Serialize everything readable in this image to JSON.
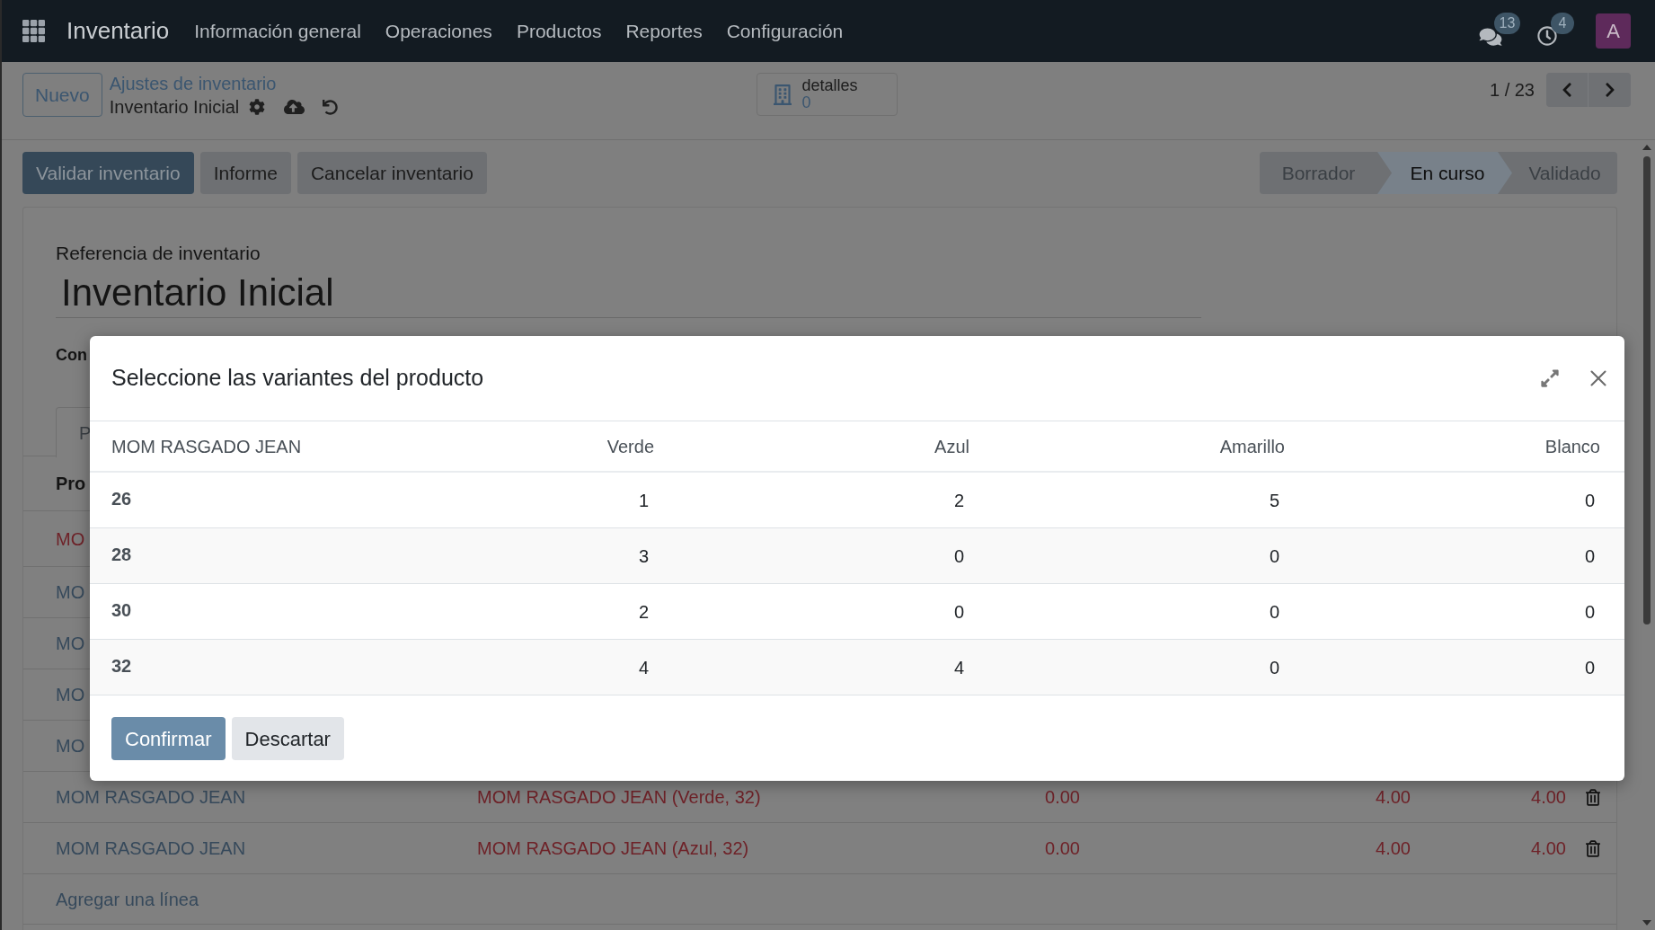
{
  "navbar": {
    "app_name": "Inventario",
    "menu": [
      "Información general",
      "Operaciones",
      "Productos",
      "Reportes",
      "Configuración"
    ],
    "messages_badge": "13",
    "activities_badge": "4",
    "avatar": "A"
  },
  "control_panel": {
    "new_button": "Nuevo",
    "breadcrumb": "Ajustes de inventario",
    "record_title": "Inventario Inicial",
    "stat_button": {
      "label": "detalles",
      "value": "0"
    },
    "pager": "1 / 23"
  },
  "actions": [
    {
      "label": "Validar inventario",
      "kind": "primary"
    },
    {
      "label": "Informe",
      "kind": "secondary"
    },
    {
      "label": "Cancelar inventario",
      "kind": "secondary"
    }
  ],
  "status_steps": [
    {
      "label": "Borrador",
      "selected": false
    },
    {
      "label": "En curso",
      "selected": true
    },
    {
      "label": "Validado",
      "selected": false
    }
  ],
  "sheet": {
    "reference_label": "Referencia de inventario",
    "reference_value": "Inventario Inicial",
    "field_label": "Con",
    "tab": "P",
    "list": {
      "column_1": "Pro",
      "rows": [
        {
          "product": "MO",
          "warning": true
        },
        {
          "product": "MO",
          "warning": false
        },
        {
          "product": "MO",
          "warning": false
        },
        {
          "product": "MO",
          "warning": false
        },
        {
          "product": "MO",
          "warning": false
        },
        {
          "product": "MOM RASGADO JEAN",
          "warning": false,
          "variant": "MOM RASGADO JEAN (Verde, 32)",
          "column_3": "0.00",
          "column_4": "4.00",
          "column_5": "4.00"
        },
        {
          "product": "MOM RASGADO JEAN",
          "warning": false,
          "variant": "MOM RASGADO JEAN (Azul, 32)",
          "column_3": "0.00",
          "column_4": "4.00",
          "column_5": "4.00"
        }
      ],
      "add_line": "Agregar una línea"
    }
  },
  "dialog": {
    "title": "Seleccione las variantes del producto",
    "columns": [
      "MOM RASGADO JEAN",
      "Verde",
      "Azul",
      "Amarillo",
      "Blanco"
    ],
    "rows": [
      {
        "label": "26",
        "values": [
          "1",
          "2",
          "5",
          "0"
        ]
      },
      {
        "label": "28",
        "values": [
          "3",
          "0",
          "0",
          "0"
        ]
      },
      {
        "label": "30",
        "values": [
          "2",
          "0",
          "0",
          "0"
        ]
      },
      {
        "label": "32",
        "values": [
          "4",
          "4",
          "0",
          "0"
        ]
      }
    ],
    "buttons": [
      {
        "label": "Confirmar",
        "kind": "primary"
      },
      {
        "label": "Descartar",
        "kind": "secondary"
      }
    ]
  }
}
